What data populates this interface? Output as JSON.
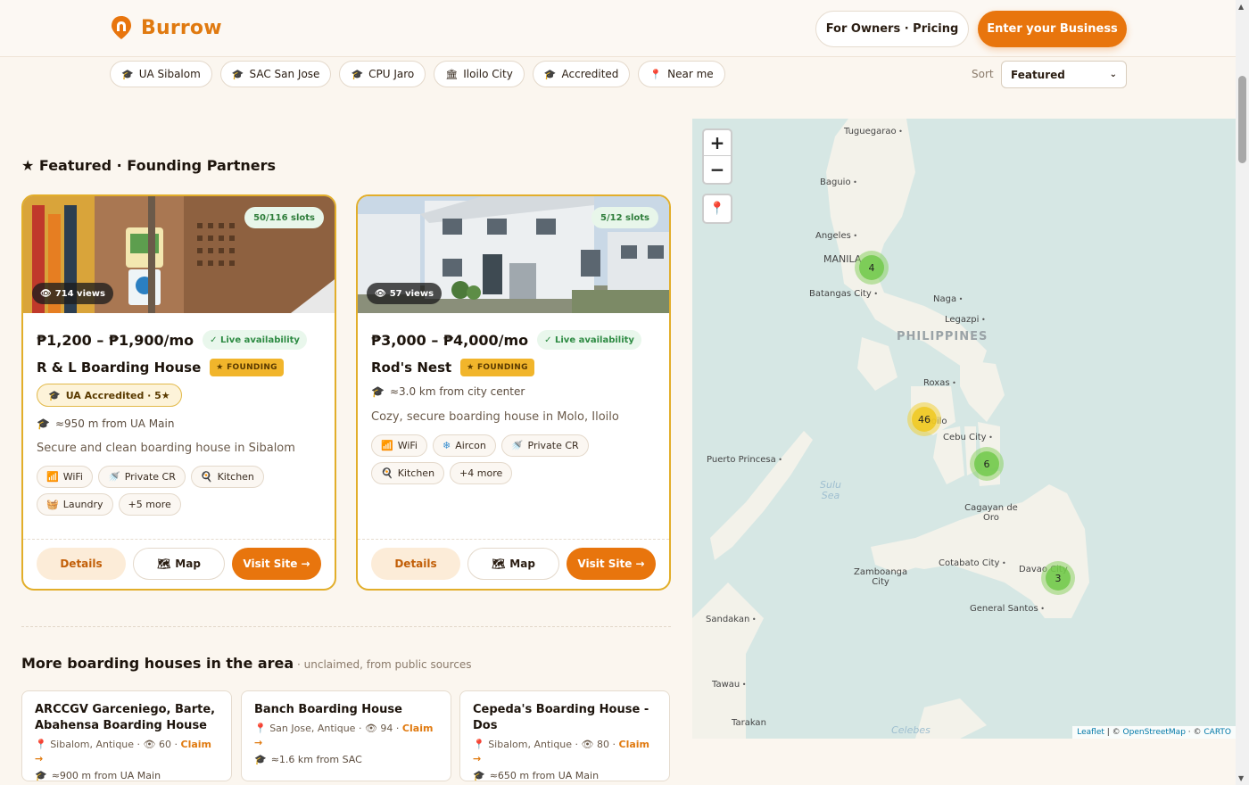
{
  "brand": {
    "name": "Burrow",
    "accent": "#e8750d"
  },
  "header": {
    "owners_label": "For Owners · Pricing",
    "enter_label": "Enter your Business"
  },
  "filters": [
    {
      "icon": "graduation-cap-icon",
      "label": "UA Sibalom"
    },
    {
      "icon": "graduation-cap-icon",
      "label": "SAC San Jose"
    },
    {
      "icon": "graduation-cap-icon",
      "label": "CPU Jaro"
    },
    {
      "icon": "city-icon",
      "label": "Iloilo City"
    },
    {
      "icon": "graduation-cap-icon",
      "label": "Accredited"
    },
    {
      "icon": "pin-icon",
      "label": "Near me"
    }
  ],
  "sort": {
    "label": "Sort",
    "value": "Featured"
  },
  "featured": {
    "title": "★ Featured · Founding Partners",
    "cards": [
      {
        "slots": "50/116 slots",
        "views": "714 views",
        "price": "₱1,200 – ₱1,900/mo",
        "live": "✓ Live availability",
        "name": "R & L Boarding House",
        "badge": "★ FOUNDING",
        "accredited": "UA Accredited · 5★",
        "distance": "≈950 m from UA Main",
        "description": "Secure and clean boarding house in Sibalom",
        "amenities": [
          "WiFi",
          "Private CR",
          "Kitchen",
          "Laundry",
          "+5 more"
        ],
        "details": "Details",
        "map": "Map",
        "visit": "Visit Site →"
      },
      {
        "slots": "5/12 slots",
        "views": "57 views",
        "price": "₱3,000 – ₱4,000/mo",
        "live": "✓ Live availability",
        "name": "Rod's Nest",
        "badge": "★ FOUNDING",
        "distance": "≈3.0 km from city center",
        "description": "Cozy, secure boarding house in Molo, Iloilo",
        "amenities": [
          "WiFi",
          "Aircon",
          "Private CR",
          "Kitchen",
          "+4 more"
        ],
        "details": "Details",
        "map": "Map",
        "visit": "Visit Site →"
      }
    ]
  },
  "more": {
    "title": "More boarding houses in the area",
    "subtitle": " · unclaimed, from public sources",
    "items": [
      {
        "name": "ARCCGV Garceniego, Barte, Abahensa Boarding House",
        "location": "Sibalom, Antique",
        "views": "60",
        "claim": "Claim →",
        "distance": "≈900 m from UA Main"
      },
      {
        "name": "Banch Boarding House",
        "location": "San Jose, Antique",
        "views": "94",
        "claim": "Claim →",
        "distance": "≈1.6 km from SAC"
      },
      {
        "name": "Cepeda's Boarding House - Dos",
        "location": "Sibalom, Antique",
        "views": "80",
        "claim": "Claim →",
        "distance": "≈650 m from UA Main"
      }
    ]
  },
  "map": {
    "zoom_in": "+",
    "zoom_out": "−",
    "country": "PHILIPPINES",
    "cities": [
      "Tuguegarao",
      "Baguio",
      "Angeles",
      "MANILA",
      "Batangas City",
      "Naga",
      "Legazpi",
      "Roxas",
      "Iloilo",
      "Cebu City",
      "Puerto Princesa",
      "Cagayan de Oro",
      "Cotabato City",
      "Davao City",
      "Zamboanga City",
      "General Santos",
      "Sandakan",
      "Tawau",
      "Tarakan"
    ],
    "seas": [
      "Sulu Sea",
      "Celebes"
    ],
    "clusters": [
      {
        "count": "4",
        "color": "green"
      },
      {
        "count": "46",
        "color": "yellow"
      },
      {
        "count": "6",
        "color": "green"
      },
      {
        "count": "3",
        "color": "green"
      }
    ],
    "attribution": {
      "leaflet": "Leaflet",
      "osm": "OpenStreetMap",
      "carto": "CARTO"
    }
  }
}
